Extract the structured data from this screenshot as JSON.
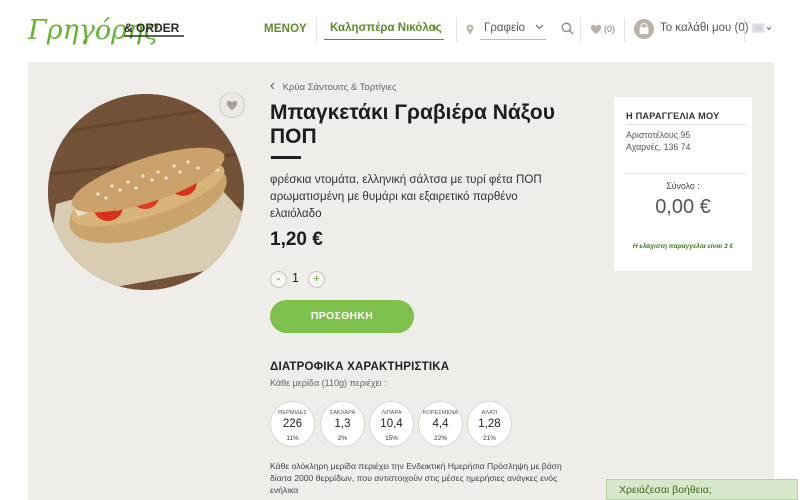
{
  "header": {
    "logo_text": "Γρηγόρης & ORDER",
    "menu_label": "ΜΕΝΟΥ",
    "greeting": "Καλησπέρα Νικόλας",
    "location": "Γραφείο",
    "favorites_count": "(0)",
    "basket_label": "Το καλάθι μου (0)",
    "colors": {
      "brand_green": "#5a8c2a",
      "button_green": "#7dc04b"
    }
  },
  "product": {
    "breadcrumb": "Κρύα Σάντουιτς & Τορτίγιες",
    "title": "Μπαγκετάκι Γραβιέρα Νάξου ΠΟΠ",
    "description": "φρέσκια ντομάτα, ελληνική σάλτσα με τυρί φέτα ΠΟΠ αρωματισμένη με θυμάρι και εξαιρετικό παρθένο ελαιόλαδο",
    "price": "1,20 €",
    "quantity": "1",
    "qty_minus": "-",
    "qty_plus": "+",
    "add_button": "ΠΡΟΣΘΗΚΗ"
  },
  "nutrition": {
    "title": "ΔΙΑΤΡΟΦΙΚΑ ΧΑΡΑΚΤΗΡΙΣΤΙΚΑ",
    "subtitle": "Κάθε μερίδα (110g) περιέχει :",
    "items": [
      {
        "label": "ΘΕΡΜΙΔΕΣ",
        "value": "226",
        "percent": "11%"
      },
      {
        "label": "ΣΑΚΧΑΡΑ",
        "value": "1,3",
        "percent": "2%"
      },
      {
        "label": "ΛΙΠΑΡΑ",
        "value": "10,4",
        "percent": "15%"
      },
      {
        "label": "ΚΟΡΕΣΜΕΝΑ",
        "value": "4,4",
        "percent": "22%"
      },
      {
        "label": "ΑΛΑΤΙ",
        "value": "1,28",
        "percent": "21%"
      }
    ],
    "disclaimer": "Κάθε ολόκληρη μερίδα περιέχει την Ενδεικτική Ημερήσια Πρόσληψη με βάση δίαιτα 2000 θερμίδων, που αντιστοιχούν στις μέσες ημερήσιες ανάγκες ενός ενήλικα"
  },
  "order": {
    "title": "Η ΠΑΡΑΓΓΕΛΙΑ ΜΟΥ",
    "address_line1": "Αριστοτέλους 95",
    "address_line2": "Αχαρνές, 136 74",
    "total_label": "Σύνολο :",
    "total_value": "0,00 €",
    "min_order": "Η ελάχιστη παραγγελία είναι 3 €"
  },
  "help": {
    "label": "Χρειάζεσαι βοήθεια;"
  }
}
